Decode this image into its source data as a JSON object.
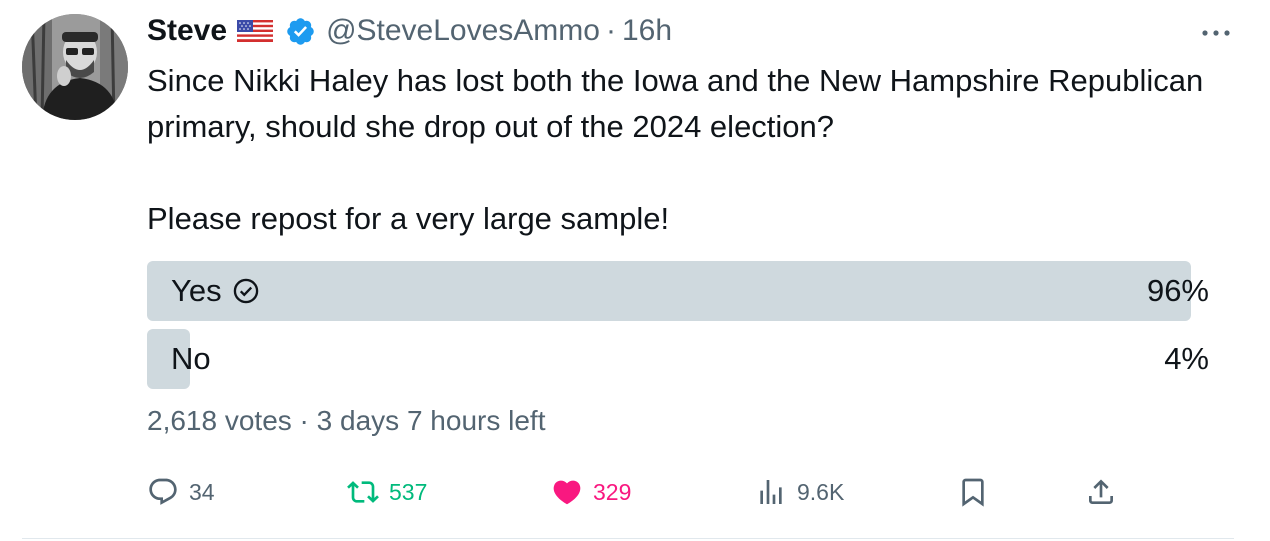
{
  "author": {
    "name": "Steve",
    "handle": "@SteveLovesAmmo",
    "separator": "·",
    "time": "16h",
    "flag_icon": "us-flag-icon",
    "verified_color": "#1d9bf0"
  },
  "tweet": {
    "paragraphs": [
      "Since Nikki Haley has lost both the Iowa and the New Hampshire Republican primary, should she drop out of the 2024 election?",
      "Please repost for a very large sample!"
    ]
  },
  "poll": {
    "options": [
      {
        "label": "Yes",
        "percent_text": "96%",
        "percent": 96,
        "winner": true
      },
      {
        "label": "No",
        "percent_text": "4%",
        "percent": 4,
        "winner": false
      }
    ],
    "votes": "2,618 votes",
    "meta_separator": " · ",
    "time_left": "3 days 7 hours left",
    "bar_color": "#cfd9de"
  },
  "actions": {
    "replies": "34",
    "reposts": "537",
    "likes": "329",
    "views": "9.6K",
    "repost_color": "#00ba7c",
    "like_color": "#f91880"
  }
}
